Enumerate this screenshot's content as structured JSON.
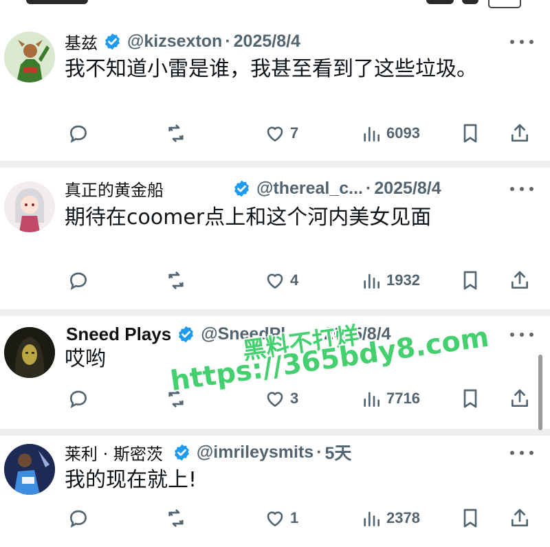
{
  "posts": [
    {
      "display_name": "基兹",
      "handle": "@kizsexton",
      "date": "2025/8/4",
      "text": "我不知道小雷是谁，我甚至看到了这些垃圾。",
      "replies": "",
      "reposts": "",
      "likes": "7",
      "views": "6093"
    },
    {
      "display_name": "真正的黄金船",
      "handle": "@thereal_c...",
      "date": "2025/8/4",
      "text": "期待在coomer点上和这个河内美女见面",
      "replies": "",
      "reposts": "",
      "likes": "4",
      "views": "1932"
    },
    {
      "display_name": "Sneed Plays",
      "handle": "@SneedPl",
      "date": "2025/8/4",
      "text": "哎哟",
      "replies": "",
      "reposts": "",
      "likes": "3",
      "views": "7716"
    },
    {
      "display_name": "莱利 · 斯密茨",
      "handle": "@imrileysmits",
      "date": "5天",
      "text": "我的现在就上!",
      "replies": "",
      "reposts": "",
      "likes": "1",
      "views": "2378"
    }
  ],
  "separator": "·",
  "watermark": {
    "line1": "黑料不打烊",
    "line2": "https://365bdy8.com"
  },
  "icons": {
    "reply": "reply-icon",
    "repost": "repost-icon",
    "like": "heart-icon",
    "views": "views-icon",
    "bookmark": "bookmark-icon",
    "share": "share-icon",
    "more": "more-icon",
    "verified": "verified-badge-icon"
  },
  "colors": {
    "verified": "#1d9bf0",
    "watermark": "#44d06e",
    "secondary_text": "#536471"
  }
}
